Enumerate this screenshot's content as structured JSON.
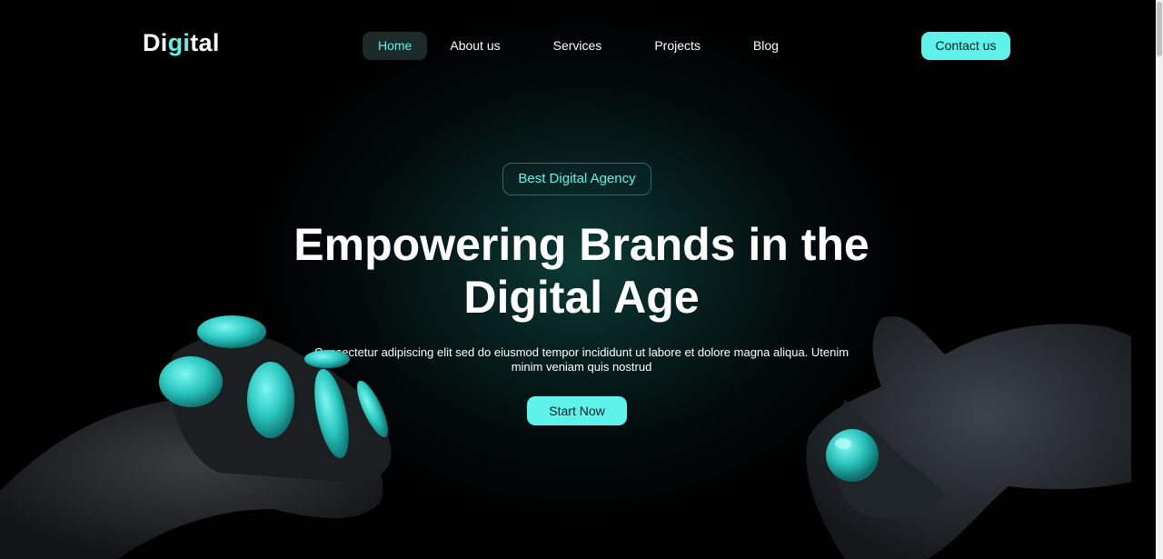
{
  "brand": {
    "logo_prefix": "Di",
    "logo_accent": "gi",
    "logo_suffix": "tal"
  },
  "nav": {
    "items": [
      {
        "label": "Home",
        "active": true
      },
      {
        "label": "About us",
        "active": false
      },
      {
        "label": "Services",
        "active": false
      },
      {
        "label": "Projects",
        "active": false
      },
      {
        "label": "Blog",
        "active": false
      }
    ],
    "contact_label": "Contact us"
  },
  "hero": {
    "badge": "Best Digital Agency",
    "headline_line1": "Empowering Brands in the",
    "headline_line2": "Digital Age",
    "subtext_line1": "Consectetur adipiscing elit sed do eiusmod tempor incididunt ut labore et dolore magna aliqua. Utenim",
    "subtext_line2": "minim veniam quis nostrud",
    "cta_label": "Start Now"
  },
  "colors": {
    "accent": "#5ef2ea",
    "background": "#000000",
    "active_nav_bg": "#1d2a2a"
  }
}
